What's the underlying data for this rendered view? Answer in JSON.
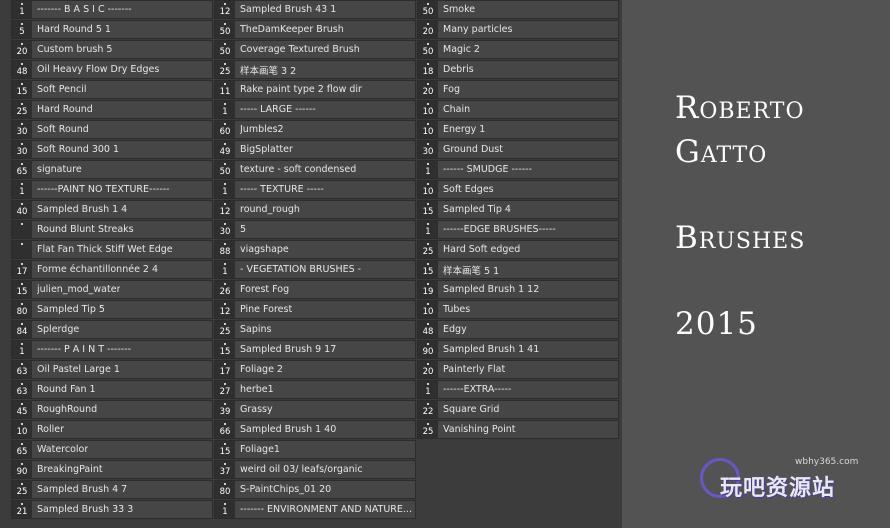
{
  "brush_columns": [
    [
      {
        "size": "1",
        "label": "------- B A S I C -------"
      },
      {
        "size": "5",
        "label": "Hard Round 5 1"
      },
      {
        "size": "20",
        "label": "Custom brush 5"
      },
      {
        "size": "48",
        "label": "Oil Heavy Flow Dry Edges"
      },
      {
        "size": "15",
        "label": "Soft Pencil"
      },
      {
        "size": "25",
        "label": "Hard Round"
      },
      {
        "size": "30",
        "label": "Soft Round"
      },
      {
        "size": "30",
        "label": "Soft Round 300 1"
      },
      {
        "size": "65",
        "label": "signature"
      },
      {
        "size": "1",
        "label": "------PAINT NO TEXTURE------"
      },
      {
        "size": "40",
        "label": "Sampled Brush 1 4"
      },
      {
        "size": "",
        "label": "Round Blunt Streaks"
      },
      {
        "size": "",
        "label": "Flat Fan Thick Stiff Wet Edge"
      },
      {
        "size": "17",
        "label": "Forme échantillonnée 2 4"
      },
      {
        "size": "15",
        "label": "julien_mod_water"
      },
      {
        "size": "80",
        "label": "Sampled Tip 5"
      },
      {
        "size": "84",
        "label": "Splerdge"
      },
      {
        "size": "1",
        "label": "------- P A I N T -------"
      },
      {
        "size": "63",
        "label": "Oil Pastel Large 1"
      },
      {
        "size": "63",
        "label": "Round Fan 1"
      },
      {
        "size": "45",
        "label": "RoughRound"
      },
      {
        "size": "10",
        "label": "Roller"
      },
      {
        "size": "65",
        "label": "Watercolor"
      },
      {
        "size": "90",
        "label": "BreakingPaint"
      },
      {
        "size": "25",
        "label": "Sampled Brush 4 7"
      },
      {
        "size": "21",
        "label": "Sampled Brush 33 3"
      }
    ],
    [
      {
        "size": "12",
        "label": "Sampled Brush 43 1"
      },
      {
        "size": "50",
        "label": "TheDamKeeper Brush"
      },
      {
        "size": "50",
        "label": "Coverage Textured Brush"
      },
      {
        "size": "25",
        "label": "样本画笔 3 2"
      },
      {
        "size": "11",
        "label": "Rake paint type 2 flow dir"
      },
      {
        "size": "1",
        "label": "----- LARGE ------"
      },
      {
        "size": "60",
        "label": "Jumbles2"
      },
      {
        "size": "49",
        "label": "BigSplatter"
      },
      {
        "size": "50",
        "label": "texture - soft condensed"
      },
      {
        "size": "1",
        "label": "----- TEXTURE -----"
      },
      {
        "size": "12",
        "label": "round_rough"
      },
      {
        "size": "30",
        "label": "5"
      },
      {
        "size": "88",
        "label": "viagshape"
      },
      {
        "size": "1",
        "label": "- VEGETATION BRUSHES -"
      },
      {
        "size": "26",
        "label": "Forest Fog"
      },
      {
        "size": "12",
        "label": "Pine Forest"
      },
      {
        "size": "25",
        "label": "Sapins"
      },
      {
        "size": "15",
        "label": "Sampled Brush 9 17"
      },
      {
        "size": "17",
        "label": "Foliage 2"
      },
      {
        "size": "27",
        "label": "herbe1"
      },
      {
        "size": "39",
        "label": "Grassy"
      },
      {
        "size": "66",
        "label": "Sampled Brush 1 40"
      },
      {
        "size": "15",
        "label": "Foliage1"
      },
      {
        "size": "37",
        "label": "weird oil 03/ leafs/organic"
      },
      {
        "size": "80",
        "label": "S-PaintChips_01 20"
      },
      {
        "size": "1",
        "label": "------- ENVIRONMENT AND NATURE..."
      }
    ],
    [
      {
        "size": "50",
        "label": "Smoke"
      },
      {
        "size": "20",
        "label": "Many particles"
      },
      {
        "size": "50",
        "label": "Magic 2"
      },
      {
        "size": "18",
        "label": "Debris"
      },
      {
        "size": "20",
        "label": "Fog"
      },
      {
        "size": "10",
        "label": "Chain"
      },
      {
        "size": "10",
        "label": "Energy 1"
      },
      {
        "size": "30",
        "label": "Ground Dust"
      },
      {
        "size": "1",
        "label": "------ SMUDGE ------"
      },
      {
        "size": "10",
        "label": "Soft Edges"
      },
      {
        "size": "15",
        "label": "Sampled Tip 4"
      },
      {
        "size": "1",
        "label": "------EDGE BRUSHES-----"
      },
      {
        "size": "25",
        "label": "Hard Soft edged"
      },
      {
        "size": "15",
        "label": "样本画笔 5 1"
      },
      {
        "size": "19",
        "label": "Sampled Brush 1 12"
      },
      {
        "size": "10",
        "label": "Tubes"
      },
      {
        "size": "48",
        "label": "Edgy"
      },
      {
        "size": "90",
        "label": "Sampled Brush 1 41"
      },
      {
        "size": "20",
        "label": "Painterly Flat"
      },
      {
        "size": "1",
        "label": "------EXTRA-----"
      },
      {
        "size": "22",
        "label": "Square Grid"
      },
      {
        "size": "25",
        "label": "Vanishing Point"
      }
    ]
  ],
  "title": {
    "line1": "Roberto",
    "line2": "Gatto",
    "line3": "Brushes",
    "line4": "2015"
  },
  "watermark": {
    "url": "wbhy365.com",
    "text": "玩吧资源站"
  }
}
